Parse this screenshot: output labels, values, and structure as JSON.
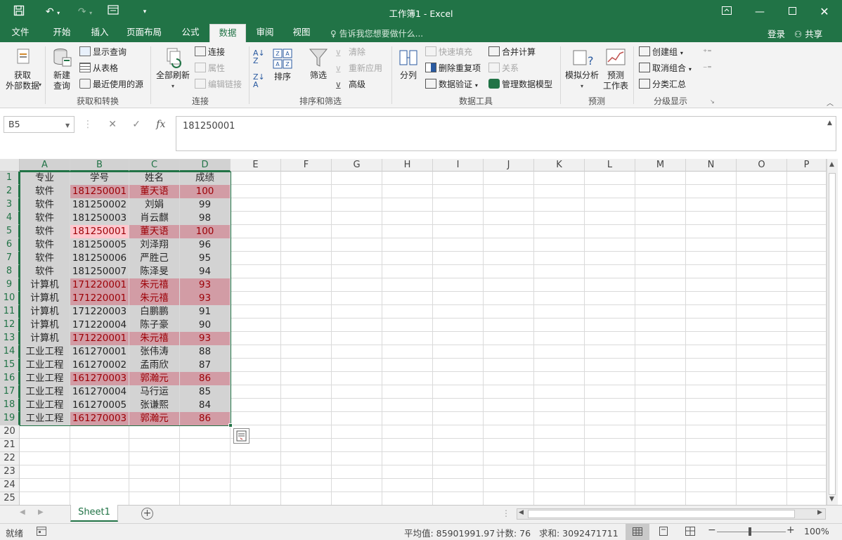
{
  "window": {
    "title": "工作簿1 - Excel",
    "qa_icons": [
      "save-icon",
      "undo-icon",
      "redo-icon",
      "form-icon",
      "customize-icon"
    ],
    "controls": [
      "ribbon-display-icon",
      "minimize-icon",
      "maximize-icon",
      "close-icon"
    ]
  },
  "menu": {
    "tabs": [
      "文件",
      "开始",
      "插入",
      "页面布局",
      "公式",
      "数据",
      "审阅",
      "视图"
    ],
    "active": "数据",
    "tell_me": "告诉我您想要做什么...",
    "login": "登录",
    "share": "共享"
  },
  "ribbon": {
    "get_external": "获取\n外部数据",
    "new_query": "新建\n查询",
    "show_query": "显示查询",
    "from_table": "从表格",
    "recent_sources": "最近使用的源",
    "group1": "获取和转换",
    "refresh_all": "全部刷新",
    "connections": "连接",
    "properties": "属性",
    "edit_links": "编辑链接",
    "group2": "连接",
    "sort": "排序",
    "filter": "筛选",
    "clear": "清除",
    "reapply": "重新应用",
    "advanced": "高级",
    "group3": "排序和筛选",
    "split": "分列",
    "flash_fill": "快速填充",
    "remove_dup": "删除重复项",
    "data_valid": "数据验证",
    "consolidate": "合并计算",
    "relations": "关系",
    "data_model": "管理数据模型",
    "group4": "数据工具",
    "whatif": "模拟分析",
    "forecast": "预测\n工作表",
    "group5": "预测",
    "group_btn": "创建组",
    "ungroup": "取消组合",
    "subtotal": "分类汇总",
    "group6": "分级显示"
  },
  "formula_bar": {
    "name_box": "B5",
    "formula": "181250001"
  },
  "columns": [
    "A",
    "B",
    "C",
    "D",
    "E",
    "F",
    "G",
    "H",
    "I",
    "J",
    "K",
    "L",
    "M",
    "N",
    "O",
    "P"
  ],
  "rows": [
    "1",
    "2",
    "3",
    "4",
    "5",
    "6",
    "7",
    "8",
    "9",
    "10",
    "11",
    "12",
    "13",
    "14",
    "15",
    "16",
    "17",
    "18",
    "19",
    "20",
    "21",
    "22",
    "23",
    "24",
    "25"
  ],
  "table": [
    {
      "a": "专业",
      "b": "学号",
      "c": "姓名",
      "d": "成绩",
      "dup": false
    },
    {
      "a": "软件",
      "b": "181250001",
      "c": "董天语",
      "d": "100",
      "dup": true
    },
    {
      "a": "软件",
      "b": "181250002",
      "c": "刘娟",
      "d": "99",
      "dup": false
    },
    {
      "a": "软件",
      "b": "181250003",
      "c": "肖云麒",
      "d": "98",
      "dup": false
    },
    {
      "a": "软件",
      "b": "181250001",
      "c": "董天语",
      "d": "100",
      "dup": true
    },
    {
      "a": "软件",
      "b": "181250005",
      "c": "刘泽翔",
      "d": "96",
      "dup": false
    },
    {
      "a": "软件",
      "b": "181250006",
      "c": "严胜己",
      "d": "95",
      "dup": false
    },
    {
      "a": "软件",
      "b": "181250007",
      "c": "陈泽旻",
      "d": "94",
      "dup": false
    },
    {
      "a": "计算机",
      "b": "171220001",
      "c": "朱元禧",
      "d": "93",
      "dup": true
    },
    {
      "a": "计算机",
      "b": "171220001",
      "c": "朱元禧",
      "d": "93",
      "dup": true
    },
    {
      "a": "计算机",
      "b": "171220003",
      "c": "白鹏鹏",
      "d": "91",
      "dup": false
    },
    {
      "a": "计算机",
      "b": "171220004",
      "c": "陈子豪",
      "d": "90",
      "dup": false
    },
    {
      "a": "计算机",
      "b": "171220001",
      "c": "朱元禧",
      "d": "93",
      "dup": true
    },
    {
      "a": "工业工程",
      "b": "161270001",
      "c": "张伟涛",
      "d": "88",
      "dup": false
    },
    {
      "a": "工业工程",
      "b": "161270002",
      "c": "孟雨欣",
      "d": "87",
      "dup": false
    },
    {
      "a": "工业工程",
      "b": "161270003",
      "c": "郭瀚元",
      "d": "86",
      "dup": true
    },
    {
      "a": "工业工程",
      "b": "161270004",
      "c": "马行运",
      "d": "85",
      "dup": false
    },
    {
      "a": "工业工程",
      "b": "161270005",
      "c": "张谦熙",
      "d": "84",
      "dup": false
    },
    {
      "a": "工业工程",
      "b": "161270003",
      "c": "郭瀚元",
      "d": "86",
      "dup": true
    }
  ],
  "active_cell": {
    "row": 5,
    "col": "B"
  },
  "sheet": {
    "name": "Sheet1"
  },
  "status": {
    "ready": "就绪",
    "average": "平均值: 85901991.97",
    "count": "计数: 76",
    "sum": "求和: 3092471711",
    "zoom": "100%"
  },
  "colors": {
    "accent": "#217346",
    "dup_fill": "#d29ca5",
    "dup_text": "#9c0006",
    "active_fill": "#ffc7ce"
  }
}
